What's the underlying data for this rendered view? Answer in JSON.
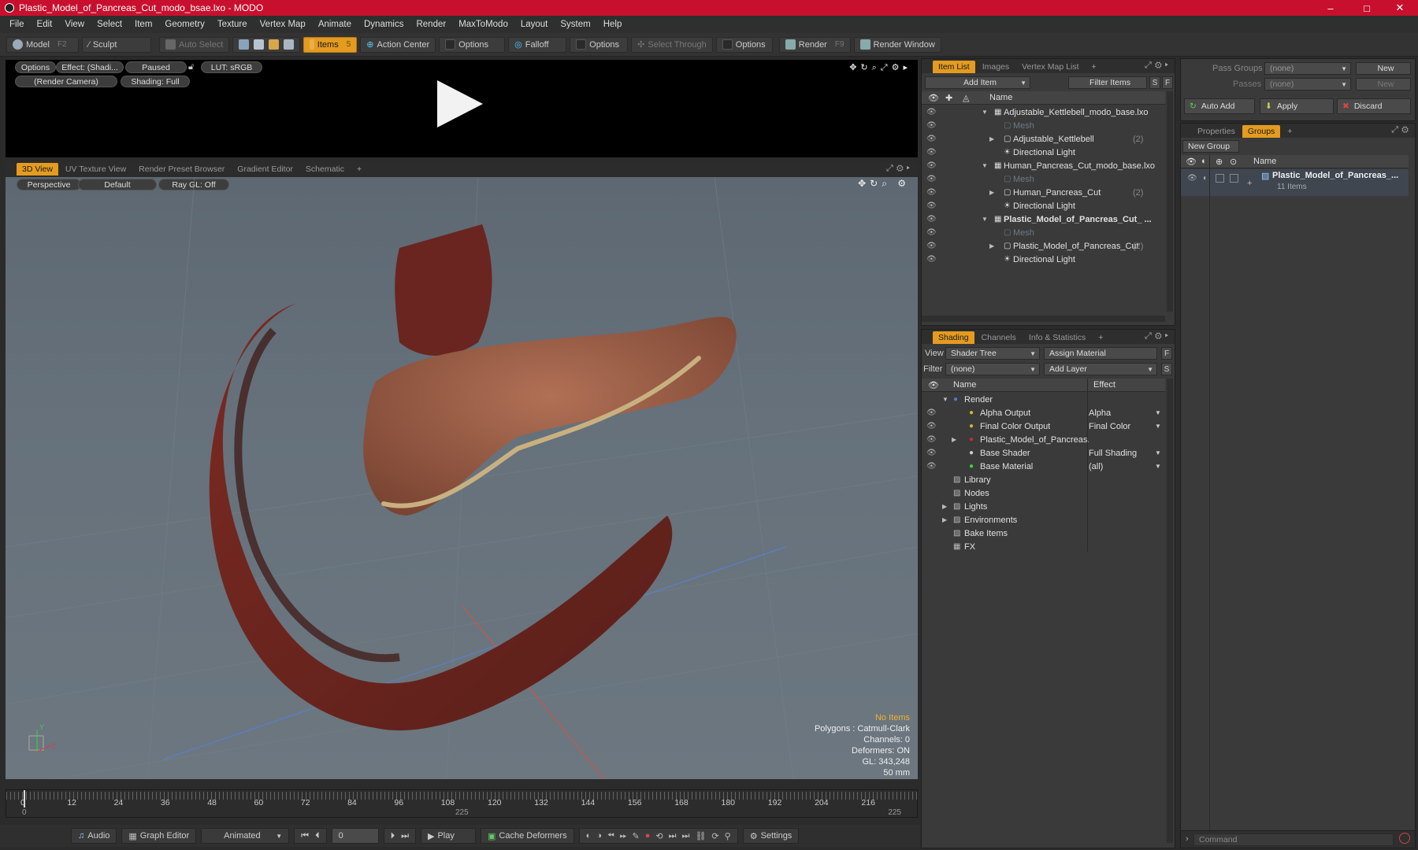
{
  "window": {
    "title": "Plastic_Model_of_Pancreas_Cut_modo_bsae.lxo - MODO",
    "minimize": "–",
    "maximize": "□",
    "close": "✕"
  },
  "menu": [
    "File",
    "Edit",
    "View",
    "Select",
    "Item",
    "Geometry",
    "Texture",
    "Vertex Map",
    "Animate",
    "Dynamics",
    "Render",
    "MaxToModo",
    "Layout",
    "System",
    "Help"
  ],
  "toolbar": {
    "model": "Model",
    "model_hotkey": "F2",
    "sculpt": "Sculpt",
    "auto_select": "Auto Select",
    "items": "Items",
    "items_hotkey": "5",
    "action_center": "Action Center",
    "options1": "Options",
    "falloff": "Falloff",
    "options2": "Options",
    "select_through": "Select Through",
    "options3": "Options",
    "render": "Render",
    "render_hotkey": "F9",
    "render_window": "Render Window"
  },
  "preview": {
    "options": "Options",
    "effect": "Effect: (Shadi...",
    "paused": "Paused",
    "lut": "LUT: sRGB",
    "camera": "(Render Camera)",
    "shading": "Shading: Full"
  },
  "viewport_tabs": [
    "3D View",
    "UV Texture View",
    "Render Preset Browser",
    "Gradient Editor",
    "Schematic",
    "+"
  ],
  "viewport": {
    "perspective": "Perspective",
    "default": "Default",
    "raygl": "Ray GL: Off",
    "info": [
      "No Items",
      "Polygons : Catmull-Clark",
      "Channels: 0",
      "Deformers: ON",
      "GL: 343,248",
      "50 mm"
    ],
    "axis_y": "Y",
    "axis_z": "Z"
  },
  "timeline": {
    "ticks": [
      "0",
      "12",
      "24",
      "36",
      "48",
      "60",
      "72",
      "84",
      "96",
      "108",
      "120",
      "132",
      "144",
      "156",
      "168",
      "180",
      "192",
      "204",
      "216"
    ],
    "start": "0",
    "mid": "225",
    "end": "225"
  },
  "bottom": {
    "audio": "Audio",
    "graph_editor": "Graph Editor",
    "animated": "Animated",
    "frame": "0",
    "play": "Play",
    "cache": "Cache Deformers",
    "settings": "Settings"
  },
  "itemlist": {
    "tabs": [
      "Item List",
      "Images",
      "Vertex Map List",
      "+"
    ],
    "add_item": "Add Item",
    "filter": "Filter Items",
    "s": "S",
    "f": "F",
    "col_name": "Name",
    "rows": [
      {
        "label": "Adjustable_Kettlebell_modo_base.lxo",
        "count": "",
        "indent": 0,
        "exp": "▼",
        "dim": false,
        "bold": false
      },
      {
        "label": "Mesh",
        "count": "",
        "indent": 1,
        "exp": "",
        "dim": true,
        "bold": false
      },
      {
        "label": "Adjustable_Kettlebell",
        "count": "(2)",
        "indent": 1,
        "exp": "▶",
        "dim": false,
        "bold": false
      },
      {
        "label": "Directional Light",
        "count": "",
        "indent": 1,
        "exp": "",
        "dim": false,
        "bold": false
      },
      {
        "label": "Human_Pancreas_Cut_modo_base.lxo",
        "count": "",
        "indent": 0,
        "exp": "▼",
        "dim": false,
        "bold": false
      },
      {
        "label": "Mesh",
        "count": "",
        "indent": 1,
        "exp": "",
        "dim": true,
        "bold": false
      },
      {
        "label": "Human_Pancreas_Cut",
        "count": "(2)",
        "indent": 1,
        "exp": "▶",
        "dim": false,
        "bold": false
      },
      {
        "label": "Directional Light",
        "count": "",
        "indent": 1,
        "exp": "",
        "dim": false,
        "bold": false
      },
      {
        "label": "Plastic_Model_of_Pancreas_Cut_ ...",
        "count": "",
        "indent": 0,
        "exp": "▼",
        "dim": false,
        "bold": true
      },
      {
        "label": "Mesh",
        "count": "",
        "indent": 1,
        "exp": "",
        "dim": true,
        "bold": false
      },
      {
        "label": "Plastic_Model_of_Pancreas_Cut",
        "count": "(2)",
        "indent": 1,
        "exp": "▶",
        "dim": false,
        "bold": false
      },
      {
        "label": "Directional Light",
        "count": "",
        "indent": 1,
        "exp": "",
        "dim": false,
        "bold": false
      }
    ]
  },
  "shading": {
    "tabs": [
      "Shading",
      "Channels",
      "Info & Statistics",
      "+"
    ],
    "view_label": "View",
    "view_value": "Shader Tree",
    "assign": "Assign Material",
    "filter_label": "Filter",
    "filter_value": "(none)",
    "add_layer": "Add Layer",
    "f": "F",
    "s": "S",
    "col_name": "Name",
    "col_effect": "Effect",
    "rows": [
      {
        "label": "Render",
        "effect": "",
        "indent": 0,
        "exp": "▼",
        "eye": false
      },
      {
        "label": "Alpha Output",
        "effect": "Alpha",
        "indent": 1,
        "exp": "",
        "eye": true
      },
      {
        "label": "Final Color Output",
        "effect": "Final Color",
        "indent": 1,
        "exp": "",
        "eye": true
      },
      {
        "label": "Plastic_Model_of_Pancreas...",
        "effect": "",
        "indent": 1,
        "exp": "▶",
        "eye": true
      },
      {
        "label": "Base Shader",
        "effect": "Full Shading",
        "indent": 1,
        "exp": "",
        "eye": true
      },
      {
        "label": "Base Material",
        "effect": "(all)",
        "indent": 1,
        "exp": "",
        "eye": true
      },
      {
        "label": "Library",
        "effect": "",
        "indent": 0,
        "exp": "",
        "eye": false
      },
      {
        "label": "Nodes",
        "effect": "",
        "indent": 0,
        "exp": "",
        "eye": false
      },
      {
        "label": "Lights",
        "effect": "",
        "indent": 0,
        "exp": "▶",
        "eye": false
      },
      {
        "label": "Environments",
        "effect": "",
        "indent": 0,
        "exp": "▶",
        "eye": false
      },
      {
        "label": "Bake Items",
        "effect": "",
        "indent": 0,
        "exp": "",
        "eye": false
      },
      {
        "label": "FX",
        "effect": "",
        "indent": 0,
        "exp": "",
        "eye": false
      }
    ]
  },
  "right": {
    "pass_groups": "Pass Groups",
    "pass_groups_value": "(none)",
    "new1": "New",
    "passes": "Passes",
    "passes_value": "(none)",
    "new2": "New",
    "auto_add": "Auto Add",
    "apply": "Apply",
    "discard": "Discard",
    "tabs": [
      "Properties",
      "Groups",
      "+"
    ],
    "new_group": "New Group",
    "col_name": "Name",
    "group_name": "Plastic_Model_of_Pancreas_...",
    "group_items": "11 Items",
    "command": "Command"
  }
}
